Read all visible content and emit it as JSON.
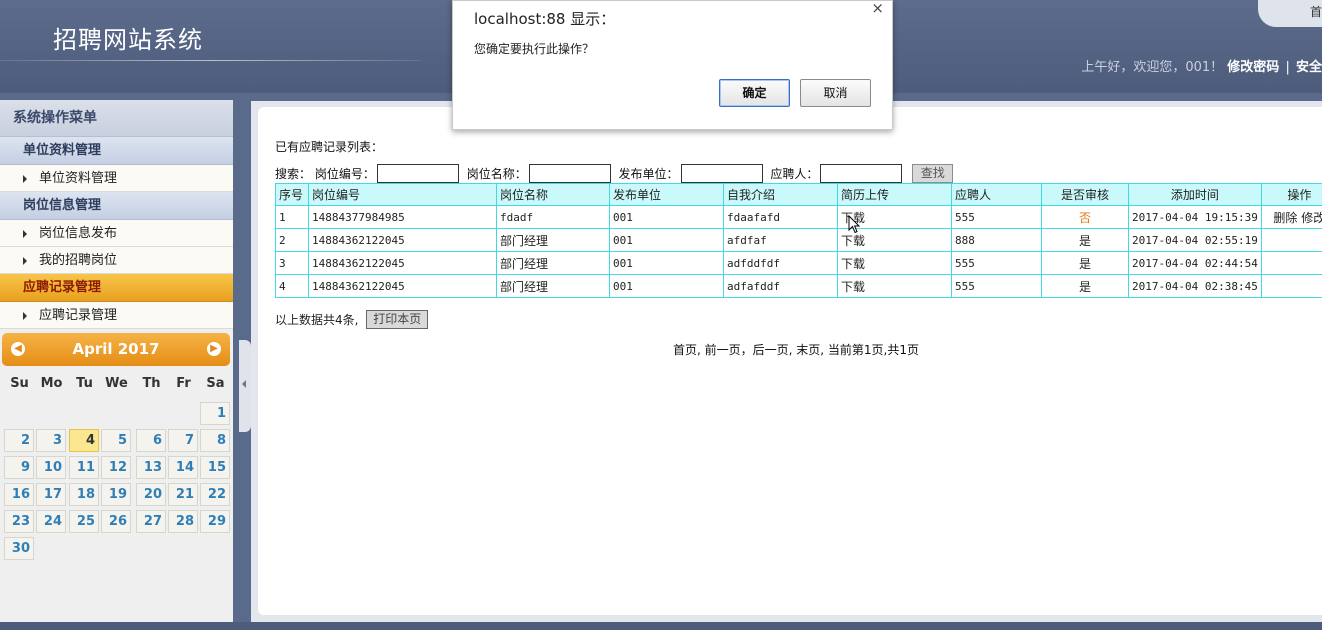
{
  "header": {
    "site_title": "招聘网站系统",
    "corner_label": "首",
    "greeting": "上午好，欢迎您，001！",
    "change_password": "修改密码",
    "separator": "|",
    "security_exit": "安全"
  },
  "sidebar": {
    "title": "系统操作菜单",
    "groups": [
      {
        "label": "单位资料管理",
        "items": [
          "单位资料管理"
        ]
      },
      {
        "label": "岗位信息管理",
        "items": [
          "岗位信息发布",
          "我的招聘岗位"
        ]
      },
      {
        "label": "应聘记录管理",
        "items": [
          "应聘记录管理"
        ],
        "active": true
      }
    ]
  },
  "calendar": {
    "title": "April 2017",
    "prev": "◀",
    "next": "▶",
    "weekdays": [
      "Su",
      "Mo",
      "Tu",
      "We",
      "Th",
      "Fr",
      "Sa"
    ],
    "days": [
      "1",
      "2",
      "3",
      "4",
      "5",
      "6",
      "7",
      "8",
      "9",
      "10",
      "11",
      "12",
      "13",
      "14",
      "15",
      "16",
      "17",
      "18",
      "19",
      "20",
      "21",
      "22",
      "23",
      "24",
      "25",
      "26",
      "27",
      "28",
      "29",
      "30"
    ],
    "today": "4"
  },
  "main": {
    "list_title": "已有应聘记录列表：",
    "search": {
      "label": "搜索：",
      "fields": [
        "岗位编号：",
        "岗位名称：",
        "发布单位：",
        "应聘人："
      ],
      "button": "查找"
    },
    "table": {
      "columns": [
        "序号",
        "岗位编号",
        "岗位名称",
        "发布单位",
        "自我介绍",
        "简历上传",
        "应聘人",
        "是否审核",
        "添加时间",
        "操作"
      ],
      "rows": [
        {
          "no": "1",
          "code": "14884377984985",
          "name": "fdadf",
          "unit": "001",
          "intro": "fdaafafd",
          "resume": "下载",
          "applicant": "555",
          "audited": "否",
          "time": "2017-04-04 19:15:39",
          "ops": "删除 修改"
        },
        {
          "no": "2",
          "code": "14884362122045",
          "name": "部门经理",
          "unit": "001",
          "intro": "afdfaf",
          "resume": "下载",
          "applicant": "888",
          "audited": "是",
          "time": "2017-04-04 02:55:19",
          "ops": ""
        },
        {
          "no": "3",
          "code": "14884362122045",
          "name": "部门经理",
          "unit": "001",
          "intro": "adfddfdf",
          "resume": "下载",
          "applicant": "555",
          "audited": "是",
          "time": "2017-04-04 02:44:54",
          "ops": ""
        },
        {
          "no": "4",
          "code": "14884362122045",
          "name": "部门经理",
          "unit": "001",
          "intro": "adfafddf",
          "resume": "下载",
          "applicant": "555",
          "audited": "是",
          "time": "2017-04-04 02:38:45",
          "ops": ""
        }
      ]
    },
    "total_text": "以上数据共4条,",
    "print_button": "打印本页",
    "pager": "首页, 前一页，后一页, 末页, 当前第1页,共1页"
  },
  "dialog": {
    "title": "localhost:88 显示：",
    "close": "×",
    "message": "您确定要执行此操作？",
    "ok": "确定",
    "cancel": "取消"
  }
}
